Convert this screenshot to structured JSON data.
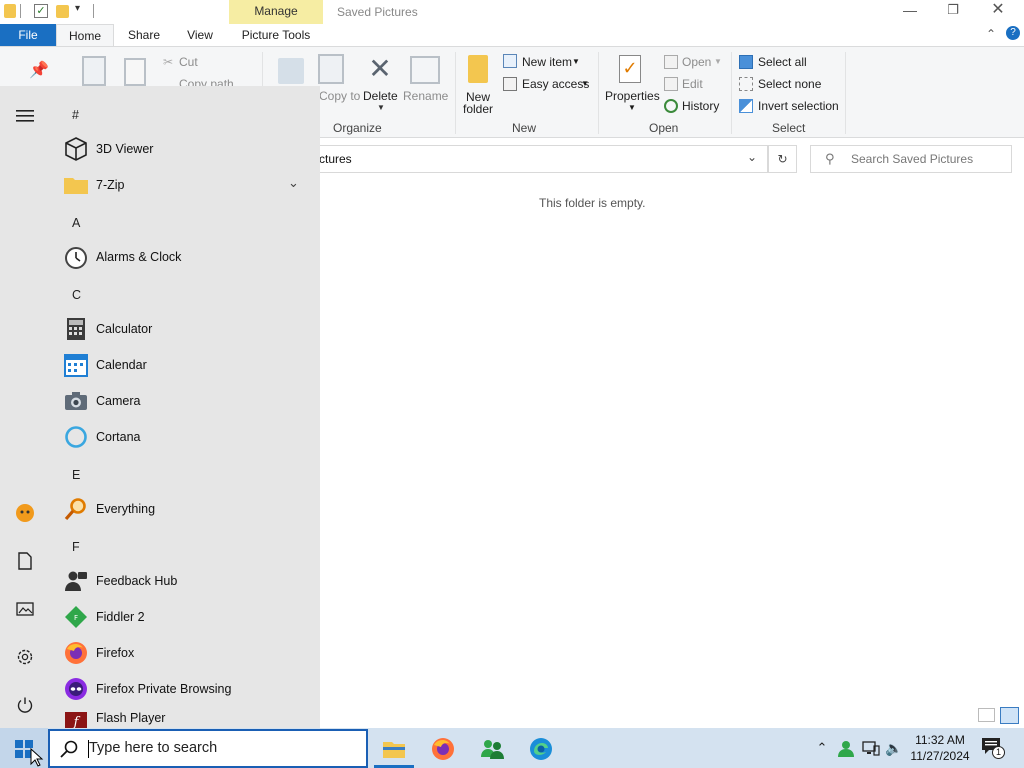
{
  "window": {
    "title": "Saved Pictures",
    "manage_label": "Manage",
    "tabs": [
      "File",
      "Home",
      "Share",
      "View",
      "Picture Tools"
    ]
  },
  "ribbon": {
    "clipboard": {
      "cut": "Cut",
      "copy_path": "Copy path"
    },
    "organize": {
      "label": "Organize",
      "copy_to": "Copy to",
      "delete": "Delete",
      "rename": "Rename"
    },
    "new": {
      "label": "New",
      "new_folder_line1": "New",
      "new_folder_line2": "folder",
      "new_item": "New item",
      "easy_access": "Easy access"
    },
    "open": {
      "label": "Open",
      "properties": "Properties",
      "open": "Open",
      "edit": "Edit",
      "history": "History"
    },
    "select": {
      "label": "Select",
      "select_all": "Select all",
      "select_none": "Select none",
      "invert": "Invert selection"
    }
  },
  "address": {
    "path_fragment": "ctures",
    "search_placeholder": "Search Saved Pictures"
  },
  "content": {
    "empty_message": "This folder is empty."
  },
  "start_menu": {
    "headers": {
      "hash": "#",
      "a": "A",
      "c": "C",
      "e": "E",
      "f": "F"
    },
    "apps": {
      "viewer3d": "3D Viewer",
      "zip": "7-Zip",
      "alarms": "Alarms & Clock",
      "calculator": "Calculator",
      "calendar": "Calendar",
      "camera": "Camera",
      "cortana": "Cortana",
      "everything": "Everything",
      "feedback": "Feedback Hub",
      "fiddler": "Fiddler 2",
      "firefox": "Firefox",
      "firefox_private": "Firefox Private Browsing",
      "flash": "Flash Player"
    }
  },
  "taskbar": {
    "search_placeholder": "Type here to search",
    "time": "11:32 AM",
    "date": "11/27/2024",
    "notification_count": "1"
  },
  "colors": {
    "accent": "#1a6fc2",
    "manage": "#f6eda3",
    "start_bg": "#e6e6e6",
    "taskbar": "#d4e2f0"
  }
}
